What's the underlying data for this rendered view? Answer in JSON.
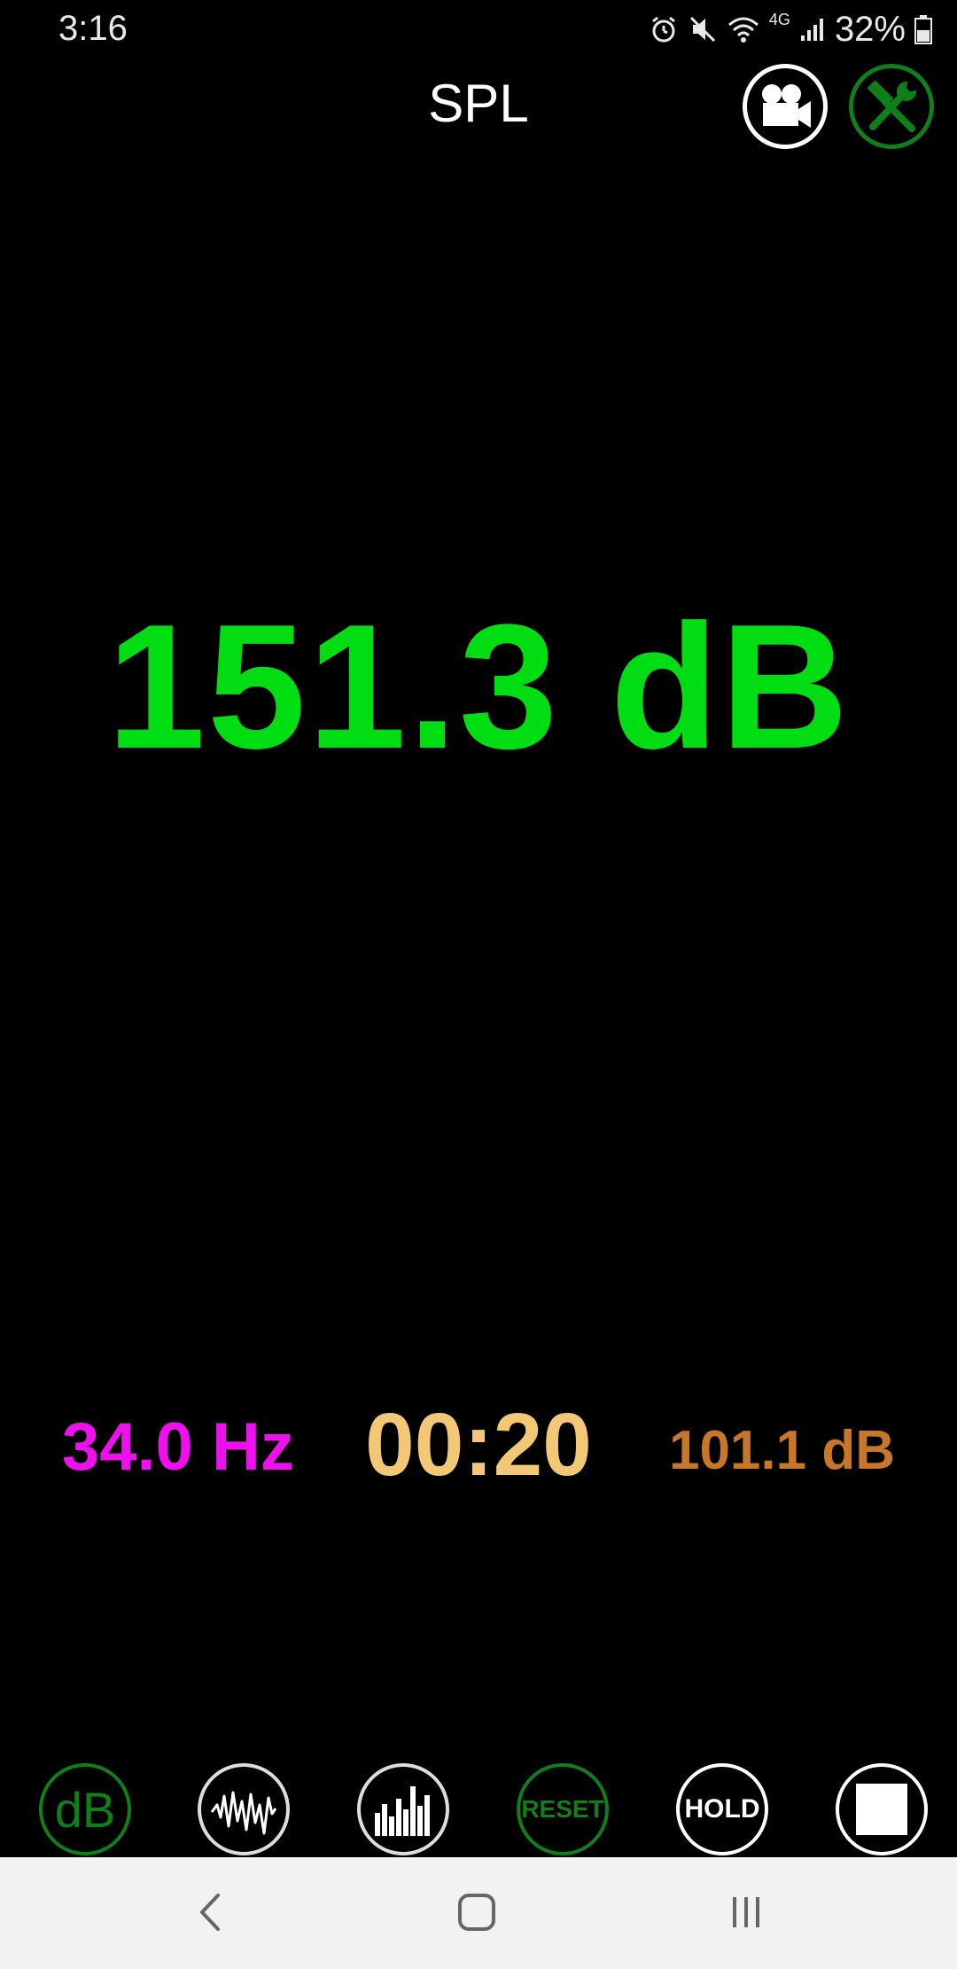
{
  "status_bar": {
    "time": "3:16",
    "battery_percent": "32%",
    "network_label": "4G",
    "icons": [
      "alarm-icon",
      "mute-icon",
      "wifi-icon",
      "4g-icon",
      "signal-icon",
      "battery-icon"
    ]
  },
  "header": {
    "title": "SPL",
    "buttons": [
      "video-camera-icon",
      "tools-icon"
    ]
  },
  "reading": {
    "value": "151.3 dB"
  },
  "stats": {
    "frequency": "34.0 Hz",
    "elapsed": "00:20",
    "peak": "101.1 dB"
  },
  "toolbar": {
    "db_label": "dB",
    "reset_label": "RESET",
    "hold_label": "HOLD",
    "icons": [
      "waveform-icon",
      "spectrum-icon",
      "stop-icon"
    ]
  },
  "colors": {
    "reading": "#00dd12",
    "frequency": "#ee11ee",
    "timer": "#f2c877",
    "peak": "#c8762a",
    "accent_green": "#0f7f1a"
  },
  "navigation": {
    "items": [
      "back-icon",
      "home-icon",
      "recents-icon"
    ]
  }
}
